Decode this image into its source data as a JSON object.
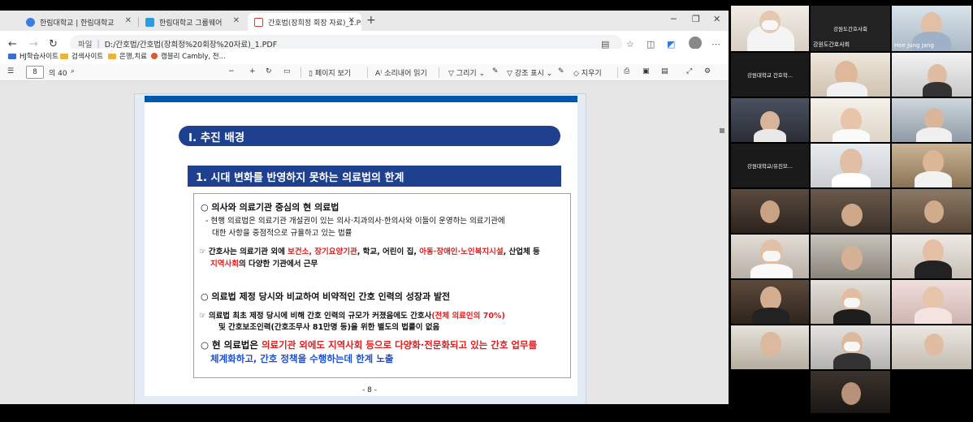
{
  "browser": {
    "tabs": [
      {
        "label": "한림대학교 | 한림대학교",
        "active": false
      },
      {
        "label": "한림대학교 그룹웨어",
        "active": false
      },
      {
        "label": "간호법(장희정 회장 자료)_1.PDF",
        "active": true
      }
    ],
    "url_label": "파일",
    "url": "D:/간호법/간호법(장희정%20회장%20자료)_1.PDF",
    "bookmarks": [
      "HJ학습사이트",
      "검색사이트",
      "은행,치료",
      "캠블리 Cambly, 전..."
    ]
  },
  "pdf_toolbar": {
    "page_current": "8",
    "page_total": "의 40",
    "page_view": "페이지 보기",
    "read_aloud": "소리내어 읽기",
    "draw": "그리기",
    "highlight": "강조 표시",
    "erase": "지우기"
  },
  "slide": {
    "section_title": "Ⅰ. 추진 배경",
    "subtitle": "1. 시대 변화를 반영하지 못하는 의료법의 한계",
    "b1_head": "○  의사와 의료기관 중심의 현 의료법",
    "b1_l1": "- 현행 의료법은 의료기관 개설권이 있는 의사·치과의사·한의사와  이들이 운영하는 의료기관에",
    "b1_l2": "대한 사항을 중점적으로 규율하고  있는 법률",
    "b1_n1a": "☞ 간호사는 의료기관 외에 ",
    "b1_n1b": "보건소, 장기요양기관",
    "b1_n1c": ", 학교, 어린이 집,  ",
    "b1_n1d": "아동·장애인·노인복지시설",
    "b1_n1e": ", 산업체 등",
    "b1_n2a": "지역사회",
    "b1_n2b": "의 다양한 기관에서 근무",
    "b2_head": "○  의료법 제정 당시와 비교하여 비약적인 간호 인력의 성장과 발전",
    "b2_l1a": "☞ 의료법 최초 제정 당시에 비해 간호 인력의 규모가 커졌음에도 간호사",
    "b2_l1b": "(전체 의료인의 70%)",
    "b2_l2": "및 간호보조인력(간호조무사 81만명 등)을 위한 별도의 법률이 없음",
    "b3_a": "○ 현 의료법은 ",
    "b3_b": "의료기관 외에도 지역사회 등으로 다양화·전문화되고 있는 간호 업무를",
    "b3_c": "체계화하고, 간호 정책을 수행하는데 한계 노출",
    "page_number": "- 8 -"
  },
  "participants": [
    {
      "name": ""
    },
    {
      "name": "강원도간호사회"
    },
    {
      "name": "Hee Jung Jang"
    },
    {
      "name": "강원대학교 간호학..."
    },
    {
      "name": ""
    },
    {
      "name": ""
    },
    {
      "name": ""
    },
    {
      "name": ""
    },
    {
      "name": ""
    },
    {
      "name": "강원대학교/유진모..."
    },
    {
      "name": ""
    },
    {
      "name": ""
    }
  ],
  "center_label": "강원도간호사회"
}
